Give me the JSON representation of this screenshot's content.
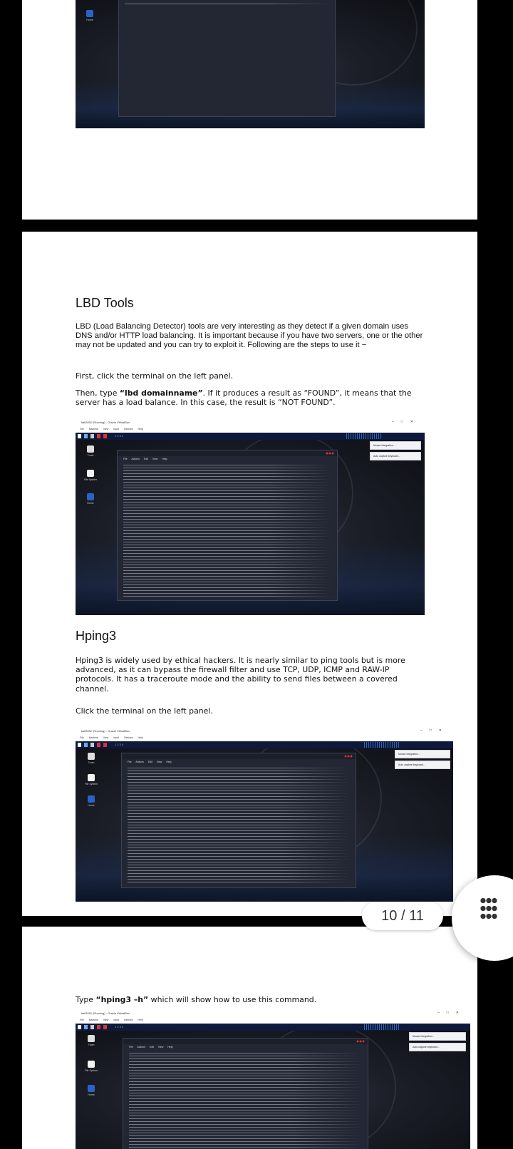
{
  "page_indicator": "10 / 11",
  "sections": {
    "lbd": {
      "title": "LBD Tools",
      "desc": "LBD (Load Balancing Detector) tools are very interesting as they detect if a given domain uses DNS and/or HTTP load balancing. It is important because if you have two servers, one or the other may not be updated and you can try to exploit it. Following are the steps to use it −",
      "step1": "First, click the terminal on the left panel.",
      "step2_pre": "Then, type ",
      "step2_cmd": "“lbd domainname”",
      "step2_post": ". If it produces a result as “FOUND”, it means that the server has a load balance. In this case, the result is “NOT FOUND”."
    },
    "hping": {
      "title": "Hping3",
      "desc": "Hping3 is widely used by ethical hackers. It is nearly similar to ping tools but is more advanced, as it can bypass the firewall filter and use TCP, UDP, ICMP and RAW-IP protocols. It has a traceroute mode and the ability to send files between a covered channel.",
      "step1": "Click the terminal on the left panel.",
      "step2_pre": "Type ",
      "step2_cmd": "“hping3 –h”",
      "step2_post": " which will show how to use this command."
    }
  },
  "screenshot": {
    "window_title": "kali2052 (Running) - Oracle VirtualBox",
    "menu": "File Machine View Input Devices Help",
    "workspaces": "1 2 3 4",
    "terminal_menu": "File Actions Edit View Help",
    "desktop_icons": [
      "Trash",
      "File System",
      "Home"
    ],
    "side_cards": [
      "Mouse integration...",
      "Auto capture keyboard..."
    ]
  },
  "colors": {
    "terminal_bg": "#222733",
    "vm_bar": "#0d1a3c",
    "page_bg": "#000000"
  }
}
